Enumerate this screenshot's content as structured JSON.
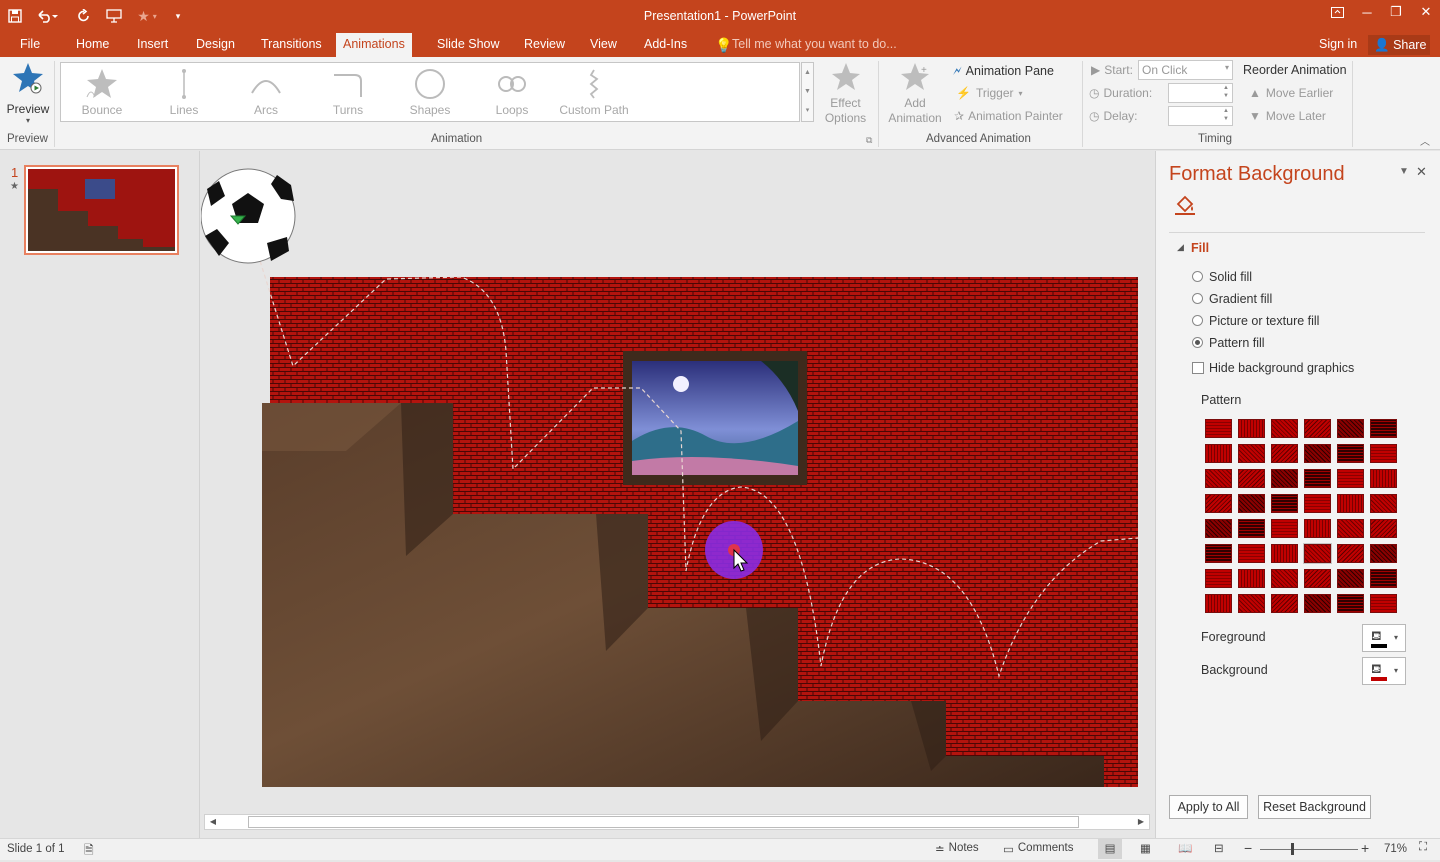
{
  "window": {
    "title": "Presentation1 - PowerPoint"
  },
  "qat": {
    "save": "save-icon",
    "undo": "undo-icon",
    "redo": "redo-icon",
    "present": "present-icon",
    "star": "star-icon",
    "customize": "customize-icon"
  },
  "tabs": [
    {
      "label": "File"
    },
    {
      "label": "Home"
    },
    {
      "label": "Insert"
    },
    {
      "label": "Design"
    },
    {
      "label": "Transitions"
    },
    {
      "label": "Animations"
    },
    {
      "label": "Slide Show"
    },
    {
      "label": "Review"
    },
    {
      "label": "View"
    },
    {
      "label": "Add-Ins"
    }
  ],
  "active_tab": "Animations",
  "tell_me": "Tell me what you want to do...",
  "signin": "Sign in",
  "share": "Share",
  "ribbon": {
    "preview": {
      "label": "Preview",
      "group": "Preview"
    },
    "gallery": [
      {
        "label": "Bounce"
      },
      {
        "label": "Lines"
      },
      {
        "label": "Arcs"
      },
      {
        "label": "Turns"
      },
      {
        "label": "Shapes"
      },
      {
        "label": "Loops"
      },
      {
        "label": "Custom Path"
      }
    ],
    "effect_options": {
      "line1": "Effect",
      "line2": "Options"
    },
    "animation_group": "Animation",
    "add_animation": {
      "line1": "Add",
      "line2": "Animation"
    },
    "animation_pane": "Animation Pane",
    "trigger": "Trigger",
    "animation_painter": "Animation Painter",
    "advanced_group": "Advanced Animation",
    "start_label": "Start:",
    "start_value": "On Click",
    "duration_label": "Duration:",
    "delay_label": "Delay:",
    "reorder": "Reorder Animation",
    "move_earlier": "Move Earlier",
    "move_later": "Move Later",
    "timing_group": "Timing"
  },
  "thumbnail": {
    "number": "1",
    "star": "★"
  },
  "format_pane": {
    "title": "Format Background",
    "section": "Fill",
    "options": [
      {
        "label": "Solid fill",
        "selected": false
      },
      {
        "label": "Gradient fill",
        "selected": false
      },
      {
        "label": "Picture or texture fill",
        "selected": false
      },
      {
        "label": "Pattern fill",
        "selected": true
      }
    ],
    "hide_graphics": "Hide background graphics",
    "pattern_label": "Pattern",
    "foreground_label": "Foreground",
    "background_label": "Background",
    "apply_all": "Apply to All",
    "reset": "Reset Background",
    "foreground_color": "#000000",
    "background_color": "#c00000"
  },
  "status": {
    "slide": "Slide 1 of 1",
    "notes": "Notes",
    "comments": "Comments",
    "zoom": "71%"
  },
  "colors": {
    "accent": "#c4441d",
    "slide_red": "#b3140e",
    "wood": "#4a3324"
  }
}
